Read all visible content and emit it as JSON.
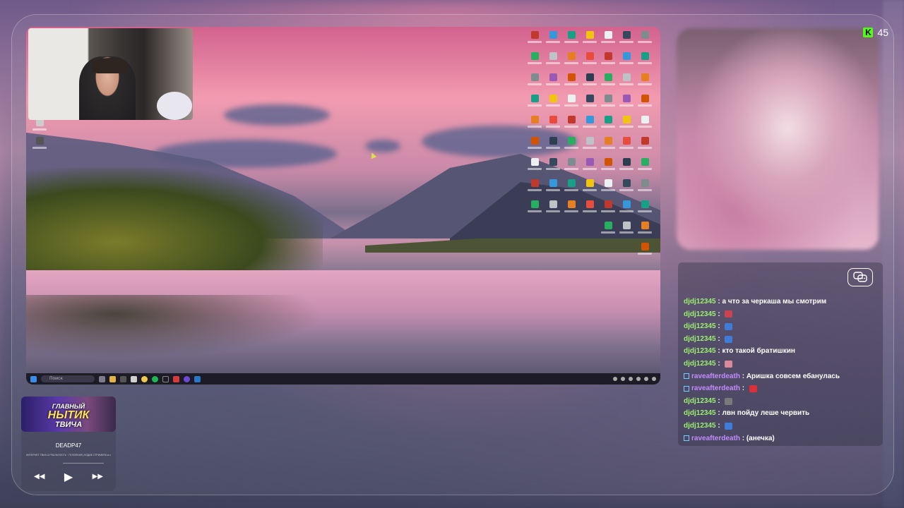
{
  "viewer_count": "45",
  "desktop": {
    "search_placeholder": "Поиск",
    "icon_colors": [
      "#c0392b",
      "#f1c40f",
      "#7f8c8d",
      "#2c3e50",
      "#e67e22",
      "#3498db",
      "#ecf0f1",
      "#9b59b6",
      "#27ae60",
      "#e74c3c",
      "#16a085",
      "#34495e",
      "#d35400",
      "#bdc3c7"
    ]
  },
  "chat": {
    "messages": [
      {
        "user": "djdj12345",
        "text": "а что за черкаша мы смотрим",
        "user_color": "#9cf06f",
        "badge": false,
        "emote": ""
      },
      {
        "user": "djdj12345",
        "text": "",
        "user_color": "#9cf06f",
        "badge": false,
        "emote": "#c9444e"
      },
      {
        "user": "djdj12345",
        "text": "",
        "user_color": "#9cf06f",
        "badge": false,
        "emote": "#3f7bd9"
      },
      {
        "user": "djdj12345",
        "text": "",
        "user_color": "#9cf06f",
        "badge": false,
        "emote": "#3f7bd9"
      },
      {
        "user": "djdj12345",
        "text": "кто такой братишкин",
        "user_color": "#9cf06f",
        "badge": false,
        "emote": ""
      },
      {
        "user": "djdj12345",
        "text": "",
        "user_color": "#9cf06f",
        "badge": false,
        "emote": "#d98a9a"
      },
      {
        "user": "raveafterdeath",
        "text": "Аришка совсем ебанулась",
        "user_color": "#c48bff",
        "badge": true,
        "emote": ""
      },
      {
        "user": "raveafterdeath",
        "text": "",
        "user_color": "#c48bff",
        "badge": true,
        "emote": "#d9303a"
      },
      {
        "user": "djdj12345",
        "text": "",
        "user_color": "#9cf06f",
        "badge": false,
        "emote": "#7a7a7a"
      },
      {
        "user": "djdj12345",
        "text": "лвн пойду леше червить",
        "user_color": "#9cf06f",
        "badge": false,
        "emote": ""
      },
      {
        "user": "djdj12345",
        "text": "",
        "user_color": "#9cf06f",
        "badge": false,
        "emote": "#3f7bd9"
      },
      {
        "user": "raveafterdeath",
        "text": "(анечка)",
        "user_color": "#c48bff",
        "badge": true,
        "emote": ""
      }
    ]
  },
  "music": {
    "album_title_line1": "ГЛАВНЫЙ",
    "album_title_line2": "НЫТИК",
    "album_title_line3": "ТВИЧА",
    "track_name": "DEADP47",
    "track_sub": "ИНТЕРНЕТ ТВИЧ & РЕАЛЬНОСТЬ · ГЕЛОЙНАЯ | КОДИК СТРИМЕРА м.с"
  }
}
